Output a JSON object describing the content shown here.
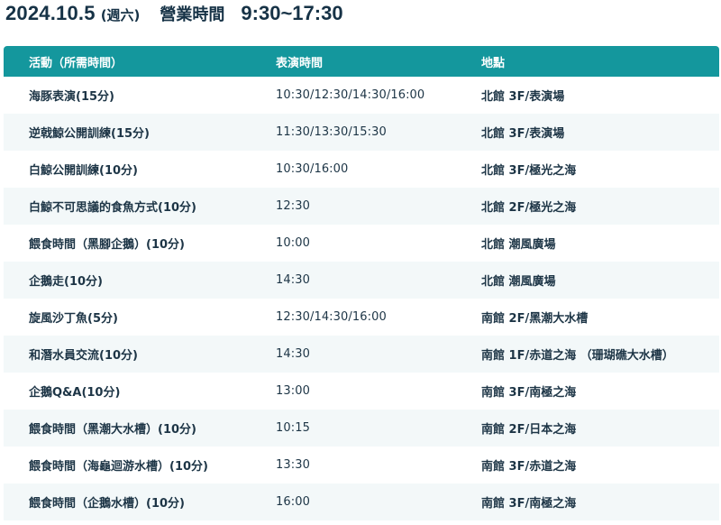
{
  "header": {
    "date": "2024.10.5",
    "weekday": "(週六)",
    "hours_label": "營業時間",
    "hours_value": "9:30~17:30"
  },
  "table": {
    "columns": [
      "活動（所需時間）",
      "表演時間",
      "地點"
    ],
    "rows": [
      {
        "activity": "海豚表演(15分)",
        "time": "10:30/12:30/14:30/16:00",
        "location": "北館 3F/表演場"
      },
      {
        "activity": "逆戟鯨公開訓練(15分)",
        "time": "11:30/13:30/15:30",
        "location": "北館 3F/表演場"
      },
      {
        "activity": "白鯨公開訓練(10分)",
        "time": "10:30/16:00",
        "location": "北館 3F/極光之海"
      },
      {
        "activity": "白鯨不可思議的食魚方式(10分)",
        "time": "12:30",
        "location": "北館 2F/極光之海"
      },
      {
        "activity": "餵食時間（黑腳企鵝）(10分)",
        "time": "10:00",
        "location": "北館 潮風廣場"
      },
      {
        "activity": "企鵝走(10分)",
        "time": "14:30",
        "location": "北館 潮風廣場"
      },
      {
        "activity": "旋風沙丁魚(5分)",
        "time": "12:30/14:30/16:00",
        "location": "南館 2F/黑潮大水槽"
      },
      {
        "activity": "和潛水員交流(10分)",
        "time": "14:30",
        "location": "南館 1F/赤道之海 （珊瑚礁大水槽）"
      },
      {
        "activity": "企鵝Q&A(10分)",
        "time": "13:00",
        "location": "南館 3F/南極之海"
      },
      {
        "activity": "餵食時間（黑潮大水槽）(10分)",
        "time": "10:15",
        "location": "南館 2F/日本之海"
      },
      {
        "activity": "餵食時間（海龜迴游水槽）(10分)",
        "time": "13:30",
        "location": "南館 3F/赤道之海"
      },
      {
        "activity": "餵食時間（企鵝水槽）(10分)",
        "time": "16:00",
        "location": "南館 3F/南極之海"
      }
    ]
  },
  "colors": {
    "header_bg": "#14979d",
    "stripe_bg": "#f3f8f9",
    "text": "#1d3546"
  }
}
